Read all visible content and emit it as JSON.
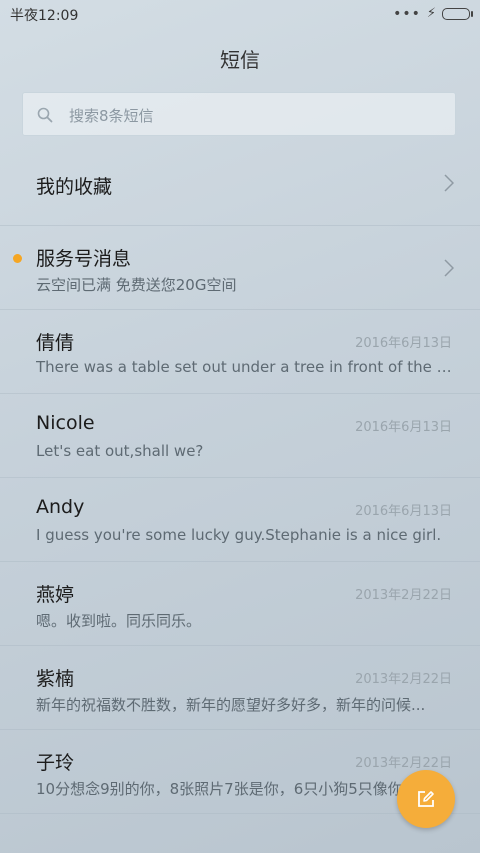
{
  "status_bar": {
    "time": "半夜12:09",
    "icons": [
      "more-dots-icon",
      "charging-bolt-icon",
      "battery-icon"
    ]
  },
  "header": {
    "title": "短信"
  },
  "search": {
    "placeholder": "搜索8条短信",
    "icon": "search-icon"
  },
  "colors": {
    "accent": "#f5a623",
    "fab": "#f5ad3a"
  },
  "favorites": {
    "label": "我的收藏"
  },
  "service": {
    "label": "服务号消息",
    "subtitle": "云空间已满 免费送您20G空间",
    "unread": true
  },
  "conversations": [
    {
      "name": "倩倩",
      "date": "2016年6月13日",
      "preview": "There was a table set out under a tree in front of the ho..."
    },
    {
      "name": "Nicole",
      "date": "2016年6月13日",
      "preview": "Let's eat out,shall we?"
    },
    {
      "name": "Andy",
      "date": "2016年6月13日",
      "preview": "I guess you're some lucky guy.Stephanie is a nice girl."
    },
    {
      "name": "燕婷",
      "date": "2013年2月22日",
      "preview": "嗯。收到啦。同乐同乐。"
    },
    {
      "name": "紫楠",
      "date": "2013年2月22日",
      "preview": "新年的祝福数不胜数，新年的愿望好多好多，新年的问候..."
    },
    {
      "name": "子玲",
      "date": "2013年2月22日",
      "preview": "10分想念9别的你，8张照片7张是你，6只小狗5只像你"
    }
  ],
  "fab": {
    "icon": "compose-icon"
  }
}
